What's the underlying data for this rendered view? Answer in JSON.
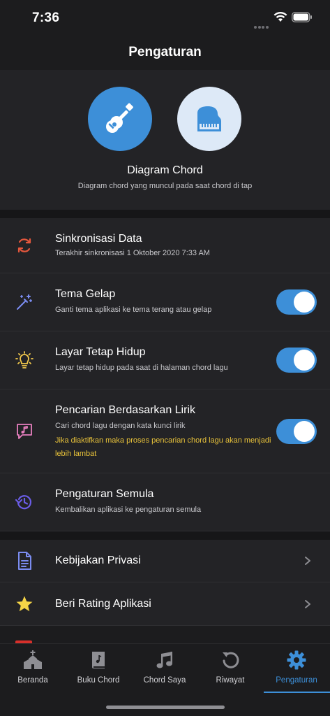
{
  "status_bar": {
    "time": "7:36"
  },
  "header": {
    "title": "Pengaturan"
  },
  "chord_diagram": {
    "title": "Diagram Chord",
    "subtitle": "Diagram chord yang muncul pada saat chord di tap",
    "options": [
      {
        "icon": "guitar-icon",
        "selected": true
      },
      {
        "icon": "piano-icon",
        "selected": false
      }
    ]
  },
  "settings": [
    {
      "icon": "sync-icon",
      "title": "Sinkronisasi Data",
      "subtitle": "Terakhir sinkronisasi 1 Oktober 2020 7:33 AM"
    },
    {
      "icon": "dark-theme-icon",
      "title": "Tema Gelap",
      "subtitle": "Ganti tema aplikasi ke tema terang atau gelap",
      "toggle": true
    },
    {
      "icon": "lightbulb-icon",
      "title": "Layar Tetap Hidup",
      "subtitle": "Layar tetap hidup pada saat di halaman chord lagu",
      "toggle": true
    },
    {
      "icon": "lyrics-search-icon",
      "title": "Pencarian Berdasarkan Lirik",
      "subtitle": "Cari chord lagu dengan kata kunci lirik",
      "warning": "Jika diaktifkan maka proses pencarian chord lagu akan menjadi lebih lambat",
      "toggle": true
    },
    {
      "icon": "restore-icon",
      "title": "Pengaturan Semula",
      "subtitle": "Kembalikan aplikasi ke pengaturan semula"
    }
  ],
  "links": [
    {
      "icon": "document-icon",
      "title": "Kebijakan Privasi"
    },
    {
      "icon": "star-icon",
      "title": "Beri Rating Aplikasi"
    }
  ],
  "tabs": [
    {
      "icon": "church-icon",
      "label": "Beranda"
    },
    {
      "icon": "book-icon",
      "label": "Buku Chord"
    },
    {
      "icon": "music-note-icon",
      "label": "Chord Saya"
    },
    {
      "icon": "history-icon",
      "label": "Riwayat"
    },
    {
      "icon": "gear-icon",
      "label": "Pengaturan",
      "active": true
    }
  ],
  "colors": {
    "accent": "#3d8fd8",
    "background": "#1c1c1e",
    "card": "#232326",
    "warning": "#e8c23a",
    "sync": "#e4573d",
    "theme_icon": "#7b8cf0",
    "bulb": "#f2c94c",
    "lyrics_icon": "#e87fbf",
    "restore_icon": "#6b5de8",
    "star": "#f5d547"
  }
}
